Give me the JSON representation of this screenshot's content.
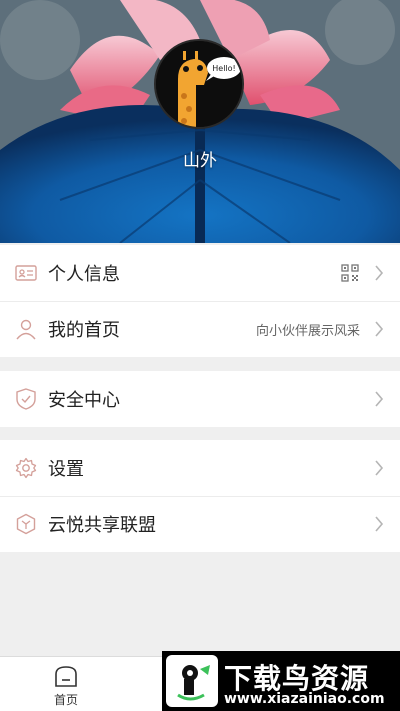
{
  "profile": {
    "username": "山外",
    "avatar_bubble_text": "Hello!"
  },
  "menu": {
    "personal_info": {
      "label": "个人信息",
      "icon": "id-card-icon",
      "trailing_icon": "qr-code-icon"
    },
    "my_homepage": {
      "label": "我的首页",
      "icon": "person-icon",
      "trailing_text": "向小伙伴展示风采"
    },
    "security_center": {
      "label": "安全中心",
      "icon": "shield-icon"
    },
    "settings": {
      "label": "设置",
      "icon": "gear-icon"
    },
    "alliance": {
      "label": "云悦共享联盟",
      "icon": "cube-icon"
    }
  },
  "tabbar": {
    "home": {
      "label": "首页",
      "icon": "home-icon"
    }
  },
  "watermark": {
    "title": "下载鸟资源",
    "url": "www.xiazainiao.com"
  },
  "colors": {
    "icon_accent": "#d4a09a",
    "chevron": "#b5b5b5",
    "background": "#efefef"
  }
}
